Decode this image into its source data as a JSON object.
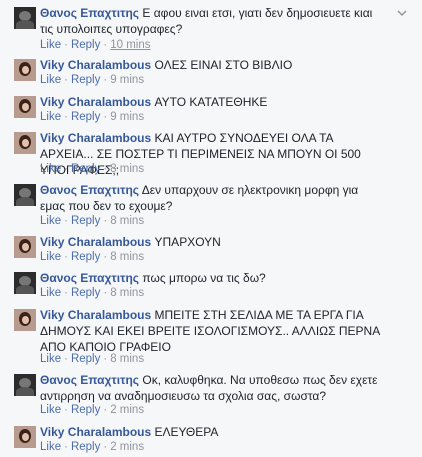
{
  "actions": {
    "like": "Like",
    "reply": "Reply",
    "separator": "·"
  },
  "comments": [
    {
      "author": "Θανος Επαχτιτης",
      "text": "Ε αφου ειναι ετσι, γιατι δεν δημοσιευετε κιαι τις υπολοιπες υπογραφες?",
      "time": "10 mins"
    },
    {
      "author": "Viky Charalambous",
      "text": "ΟΛΕΣ ΕΙΝΑΙ ΣΤΟ ΒΙΒΛΙΟ",
      "time": "9 mins"
    },
    {
      "author": "Viky Charalambous",
      "text": "ΑΥΤΟ ΚΑΤΑΤΕΘΗΚΕ",
      "time": "9 mins"
    },
    {
      "author": "Viky Charalambous",
      "text": "ΚΑΙ ΑΥΤΡΟ ΣΥΝΟΔΕΥΕΙ ΟΛΑ ΤΑ ΑΡΧΕΙΑ... ΣΕ ΠΟΣΤΕΡ ΤΙ ΠΕΡΙΜΕΝΕΙΣ ΝΑ ΜΠΟΥΝ ΟΙ 500 ΥΠΟΓΡΑΦΕΣ;;",
      "time": "8 mins"
    },
    {
      "author": "Θανος Επαχτιτης",
      "text": "Δεν υπαρχουν σε ηλεκτρονικη μορφη για εμας που δεν το εχουμε?",
      "time": "8 mins"
    },
    {
      "author": "Viky Charalambous",
      "text": "ΥΠΑΡΧΟΥΝ",
      "time": "8 mins"
    },
    {
      "author": "Θανος Επαχτιτης",
      "text": "πως μπορω να τις δω?",
      "time": "8 mins"
    },
    {
      "author": "Viky Charalambous",
      "text": "ΜΠΕΙΤΕ ΣΤΗ ΣΕΛΙΔΑ ΜΕ ΤΑ ΕΡΓΑ ΓΙΑ ΔΗΜΟΥΣ ΚΑΙ ΕΚΕΙ ΒΡΕΙΤΕ ΙΣΟΛΟΓΙΣΜΟΥΣ.. ΑΛΛΙΩΣ ΠΕΡΝΑ ΑΠΟ ΚΑΠΟΙΟ ΓΡΑΦΕΙΟ",
      "time": "8 mins"
    },
    {
      "author": "Θανος Επαχτιτης",
      "text": "Οκ, καλυφθηκα. Να υποθεσω πως δεν εχετε αντιρρηση να αναδημοσιευσω τα σχολια σας, σωστα?",
      "time": "2 mins"
    },
    {
      "author": "Viky Charalambous",
      "text": "ΕΛΕΥΘΕΡΑ",
      "time": "2 mins"
    }
  ]
}
